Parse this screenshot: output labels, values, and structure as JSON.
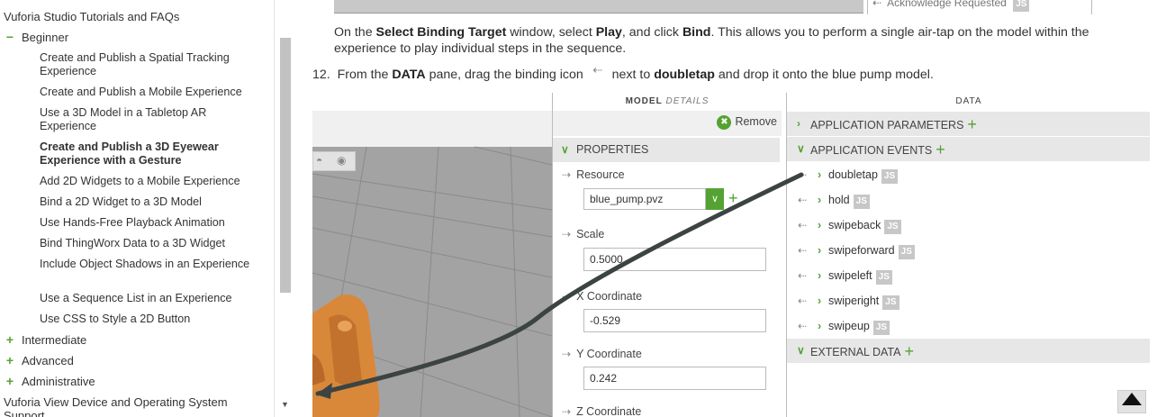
{
  "sidebar": {
    "items": [
      {
        "label": "Vuforia Studio Tutorials and FAQs"
      },
      {
        "label": "Beginner",
        "toggle": "−"
      },
      {
        "label": "Create and Publish a Spatial Tracking Experience"
      },
      {
        "label": "Create and Publish a Mobile Experience"
      },
      {
        "label": "Use a 3D Model in a Tabletop AR Experience"
      },
      {
        "label": "Create and Publish a 3D Eyewear Experience with a Gesture"
      },
      {
        "label": "Add 2D Widgets to a Mobile Experience"
      },
      {
        "label": "Bind a 2D Widget to a 3D Model"
      },
      {
        "label": "Use Hands-Free Playback Animation"
      },
      {
        "label": "Bind ThingWorx Data to a 3D Widget"
      },
      {
        "label": "Include Object Shadows in an Experience"
      },
      {
        "label": "Use a Sequence List in an Experience"
      },
      {
        "label": "Use CSS to Style a 2D Button"
      },
      {
        "label": "Intermediate",
        "toggle": "+"
      },
      {
        "label": "Advanced",
        "toggle": "+"
      },
      {
        "label": "Administrative",
        "toggle": "+"
      },
      {
        "label": "Vuforia View Device and Operating System Support"
      }
    ]
  },
  "content": {
    "prev_item": "Acknowledge Requested",
    "prev_badge": "JS",
    "para1": {
      "t1": "On the ",
      "b1": "Select Binding Target",
      "t2": " window, select ",
      "b2": "Play",
      "t3": ", and click ",
      "b3": "Bind",
      "t4": ". This allows you to perform a single air-tap on the model within the",
      "line2": "experience to play individual steps in the sequence."
    },
    "step12": {
      "num": "12.",
      "t1": "From the ",
      "b1": "DATA",
      "t2": " pane, drag the binding icon ",
      "t3": " next to ",
      "b2": "doubletap",
      "t4": " and drop it onto the blue pump model."
    }
  },
  "screenshot": {
    "model_title": "MODEL",
    "model_title_sub": "DETAILS",
    "remove_label": "Remove",
    "properties_label": "PROPERTIES",
    "resource_label": "Resource",
    "resource_value": "blue_pump.pvz",
    "scale_label": "Scale",
    "scale_value": "0.5000",
    "x_label": "X Coordinate",
    "x_value": "-0.529",
    "y_label": "Y Coordinate",
    "y_value": "0.242",
    "z_label": "Z Coordinate",
    "data_title": "DATA",
    "app_params": "APPLICATION PARAMETERS",
    "app_events": "APPLICATION EVENTS",
    "external_data": "EXTERNAL DATA",
    "events": [
      {
        "label": "doubletap",
        "badge": "JS"
      },
      {
        "label": "hold",
        "badge": "JS"
      },
      {
        "label": "swipeback",
        "badge": "JS"
      },
      {
        "label": "swipeforward",
        "badge": "JS"
      },
      {
        "label": "swipeleft",
        "badge": "JS"
      },
      {
        "label": "swiperight",
        "badge": "JS"
      },
      {
        "label": "swipeup",
        "badge": "JS"
      }
    ]
  },
  "icons": {
    "bind_arrow": "binding-icon",
    "toggle_minus": "collapse-icon",
    "toggle_plus": "expand-icon",
    "back_to_top": "back-to-top-icon"
  },
  "colors": {
    "accent_green": "#54a332",
    "model_orange": "#d9883a",
    "drag_arrow": "#3c4443"
  }
}
